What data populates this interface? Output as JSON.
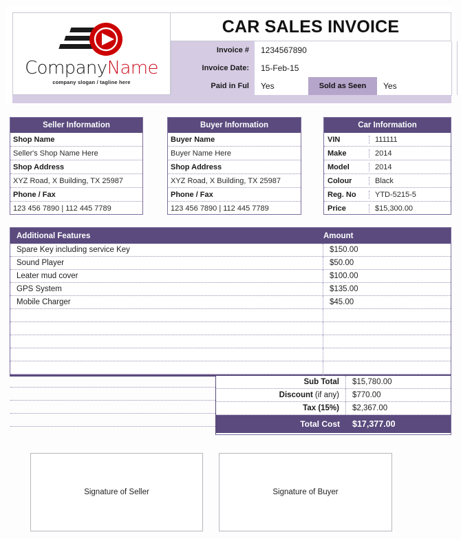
{
  "document": {
    "title": "CAR SALES INVOICE"
  },
  "logo": {
    "name_part1": "Company",
    "name_part2": "Name",
    "tagline": "company slogan / tagline here",
    "mark_icon": "play-circle-speed-logo",
    "accent_color": "#cc1122",
    "mark_color": "#cc0000"
  },
  "header_fields": {
    "invoice_number": {
      "label": "Invoice #",
      "value": "1234567890"
    },
    "invoice_date": {
      "label": "Invoice Date:",
      "value": "15-Feb-15"
    },
    "paid_in_full": {
      "label": "Paid in Ful",
      "value": "Yes"
    },
    "sold_as_seen": {
      "label": "Sold as Seen",
      "value": "Yes"
    }
  },
  "seller": {
    "heading": "Seller Information",
    "rows": [
      {
        "label": "Shop Name",
        "value": "Seller's Shop Name Here"
      },
      {
        "label": "Shop Address",
        "value": "XYZ Road, X Building, TX 25987"
      },
      {
        "label": "Phone / Fax",
        "value": "123 456 7890 | 112 445 7789"
      }
    ]
  },
  "buyer": {
    "heading": "Buyer Information",
    "rows": [
      {
        "label": "Buyer Name",
        "value": "Buyer Name Here"
      },
      {
        "label": "Shop Address",
        "value": "XYZ Road, X Building, TX 25987"
      },
      {
        "label": "Phone / Fax",
        "value": "123 456 7890 | 112 445 7789"
      }
    ]
  },
  "car": {
    "heading": "Car Information",
    "rows": [
      {
        "label": "VIN",
        "value": "111111"
      },
      {
        "label": "Make",
        "value": "2014"
      },
      {
        "label": "Model",
        "value": "2014"
      },
      {
        "label": "Colour",
        "value": "Black"
      },
      {
        "label": "Reg. No",
        "value": "YTD-5215-5"
      },
      {
        "label": "Price",
        "value": "$15,300.00"
      }
    ]
  },
  "features": {
    "col_description": "Additional Features",
    "col_amount": "Amount",
    "rows": [
      {
        "description": "Spare Key including service Key",
        "amount": "$150.00"
      },
      {
        "description": "Sound Player",
        "amount": "$50.00"
      },
      {
        "description": "Leater mud cover",
        "amount": "$100.00"
      },
      {
        "description": "GPS System",
        "amount": "$135.00"
      },
      {
        "description": "Mobile Charger",
        "amount": "$45.00"
      },
      {
        "description": "",
        "amount": ""
      },
      {
        "description": "",
        "amount": ""
      },
      {
        "description": "",
        "amount": ""
      },
      {
        "description": "",
        "amount": ""
      },
      {
        "description": "",
        "amount": ""
      },
      {
        "description": "",
        "amount": ""
      },
      {
        "description": "",
        "amount": ""
      },
      {
        "description": "",
        "amount": ""
      },
      {
        "description": "",
        "amount": ""
      }
    ]
  },
  "totals": {
    "sub_total": {
      "label": "Sub Total",
      "value": "$15,780.00"
    },
    "discount": {
      "label": "Discount",
      "label_note": "(if any)",
      "value": "$770.00"
    },
    "tax": {
      "label": "Tax (15%)",
      "value": "$2,367.00"
    },
    "total_cost": {
      "label": "Total Cost",
      "value": "$17,377.00"
    }
  },
  "signatures": {
    "seller": "Signature of Seller",
    "buyer": "Signature of Buyer"
  },
  "colors": {
    "purple": "#5a4a7d",
    "light_lavender": "#d5cbe3",
    "mid_lavender": "#b6a5cb",
    "border": "#7d6fa0"
  }
}
